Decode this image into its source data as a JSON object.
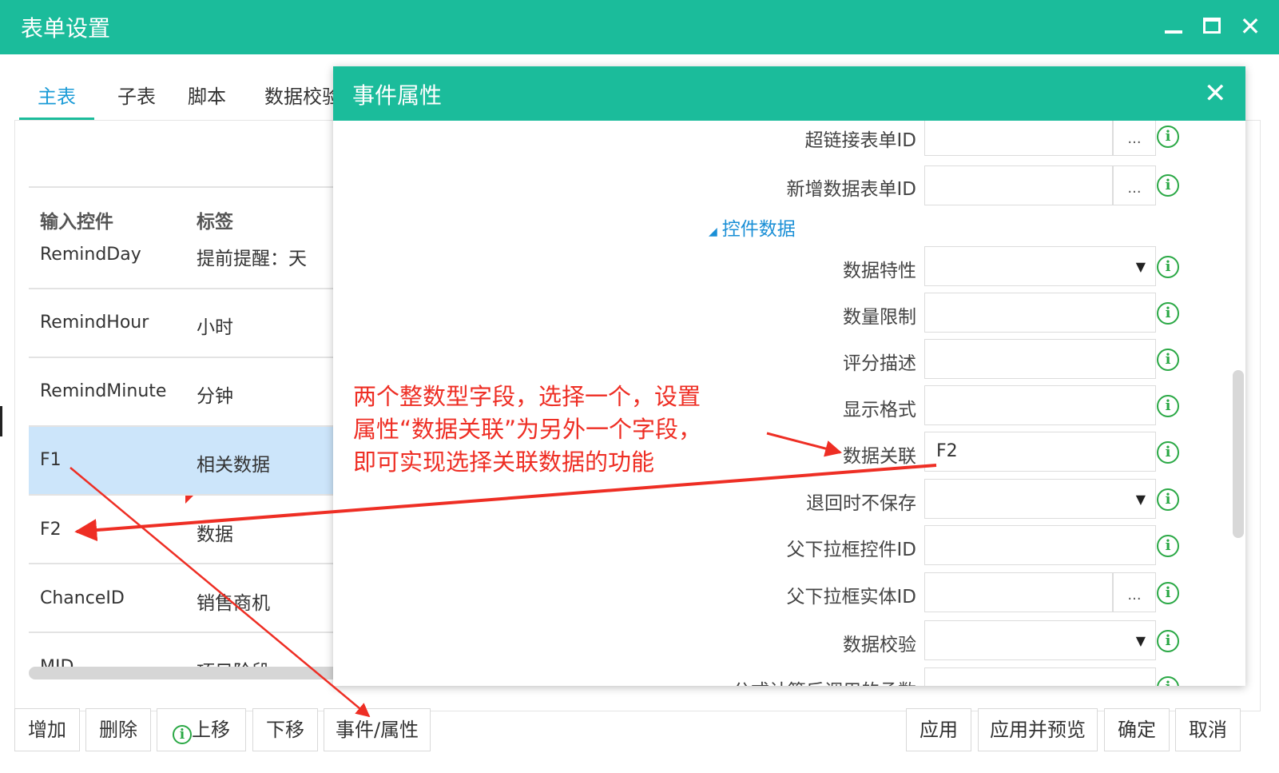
{
  "window": {
    "title": "表单设置",
    "controls": {
      "minimize": "minimize",
      "maximize": "maximize",
      "close": "✕"
    }
  },
  "tabs": [
    {
      "label": "主表",
      "active": true
    },
    {
      "label": "子表",
      "active": false
    },
    {
      "label": "脚本",
      "active": false
    },
    {
      "label": "数据校验",
      "active": false
    }
  ],
  "table": {
    "headers": {
      "input": "输入控件",
      "label": "标签"
    },
    "rows": [
      {
        "input": "RemindDay",
        "label": "提前提醒：天",
        "selected": false
      },
      {
        "input": "RemindHour",
        "label": "小时",
        "selected": false
      },
      {
        "input": "RemindMinute",
        "label": "分钟",
        "selected": false
      },
      {
        "input": "F1",
        "label": "相关数据",
        "selected": true
      },
      {
        "input": "F2",
        "label": "数据",
        "selected": false
      },
      {
        "input": "ChanceID",
        "label": "销售商机",
        "selected": false
      },
      {
        "input": "MID",
        "label": "项目阶段",
        "selected": false
      }
    ]
  },
  "buttons": {
    "add": "增加",
    "delete": "删除",
    "move_up": "上移",
    "move_down": "下移",
    "event_prop": "事件/属性",
    "apply": "应用",
    "apply_preview": "应用并预览",
    "ok": "确定",
    "cancel": "取消"
  },
  "modal": {
    "title": "事件属性",
    "close": "✕",
    "section_label": "控件数据",
    "properties": [
      {
        "label": "超链接表单ID",
        "value": "",
        "kind": "dots"
      },
      {
        "label": "新增数据表单ID",
        "value": "",
        "kind": "dots"
      },
      {
        "label": "数据特性",
        "value": "",
        "kind": "select"
      },
      {
        "label": "数量限制",
        "value": "",
        "kind": "text"
      },
      {
        "label": "评分描述",
        "value": "",
        "kind": "text"
      },
      {
        "label": "显示格式",
        "value": "",
        "kind": "text"
      },
      {
        "label": "数据关联",
        "value": "F2",
        "kind": "text"
      },
      {
        "label": "退回时不保存",
        "value": "",
        "kind": "select"
      },
      {
        "label": "父下拉框控件ID",
        "value": "",
        "kind": "text"
      },
      {
        "label": "父下拉框实体ID",
        "value": "",
        "kind": "dots"
      },
      {
        "label": "数据校验",
        "value": "",
        "kind": "select"
      },
      {
        "label": "公式计算后调用的函数",
        "value": "",
        "kind": "text"
      }
    ],
    "dots_label": "...",
    "caret": "▼",
    "info_glyph": "i"
  },
  "annotation": {
    "text": "两个整数型字段，选择一个，设置\n属性“数据关联”为另外一个字段，\n即可实现选择关联数据的功能",
    "color": "#ee2e24"
  },
  "colors": {
    "header_bg": "#1bbc9b",
    "tab_active_text": "#1a9bd7",
    "selected_row_bg": "#cce5fa",
    "info_icon": "#2aa845"
  }
}
